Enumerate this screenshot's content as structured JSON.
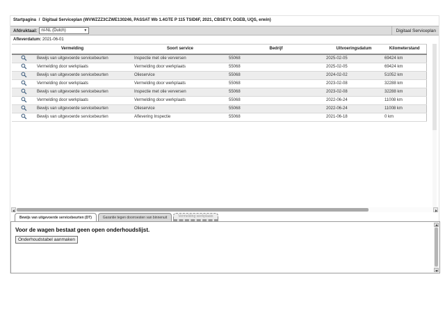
{
  "breadcrumb": {
    "home": "Startpagina",
    "separator": "/",
    "current": "Digitaal Serviceplan (WVWZZZ3CZWE130246, PASSAT Wb 1.4GTE P 115 TSID6F, 2021, CBSEYY, DGEB, UQS, erwin)"
  },
  "toolbar": {
    "language_label": "Afdruktaal:",
    "language_value": "nl-NL (Dutch)",
    "caret": "▼",
    "module_title": "Digitaal Serviceplan"
  },
  "delivery": {
    "label": "Afleverdatum:",
    "value": "2021-06-01"
  },
  "table": {
    "columns": [
      "Vermelding",
      "Soort service",
      "Bedrijf",
      "Uitvoeringsdatum",
      "Kilometerstand"
    ],
    "rows": [
      {
        "vermelding": "Bewijs van uitgevoerde servicebeurten",
        "soort_service": "Inspectie met olie verversen",
        "bedrijf": "55068",
        "uitvoeringsdatum": "2025-02-05",
        "kilometerstand": "69424 km"
      },
      {
        "vermelding": "Vermelding door werkplaats",
        "soort_service": "Vermelding door werkplaats",
        "bedrijf": "55068",
        "uitvoeringsdatum": "2025-02-05",
        "kilometerstand": "69424 km"
      },
      {
        "vermelding": "Bewijs van uitgevoerde servicebeurten",
        "soort_service": "Olieservice",
        "bedrijf": "55068",
        "uitvoeringsdatum": "2024-02-02",
        "kilometerstand": "51052 km"
      },
      {
        "vermelding": "Vermelding door werkplaats",
        "soort_service": "Vermelding door werkplaats",
        "bedrijf": "55068",
        "uitvoeringsdatum": "2023-02-08",
        "kilometerstand": "32288 km"
      },
      {
        "vermelding": "Bewijs van uitgevoerde servicebeurten",
        "soort_service": "Inspectie met olie verversen",
        "bedrijf": "55068",
        "uitvoeringsdatum": "2023-02-08",
        "kilometerstand": "32288 km"
      },
      {
        "vermelding": "Vermelding door werkplaats",
        "soort_service": "Vermelding door werkplaats",
        "bedrijf": "55068",
        "uitvoeringsdatum": "2022-06-24",
        "kilometerstand": "11008 km"
      },
      {
        "vermelding": "Bewijs van uitgevoerde servicebeurten",
        "soort_service": "Olieservice",
        "bedrijf": "55068",
        "uitvoeringsdatum": "2022-06-24",
        "kilometerstand": "11008 km"
      },
      {
        "vermelding": "Bewijs van uitgevoerde servicebeurten",
        "soort_service": "Aflevering Inspectie",
        "bedrijf": "55068",
        "uitvoeringsdatum": "2021-06-18",
        "kilometerstand": "0 km"
      }
    ],
    "row_action_icon": "magnifier-icon"
  },
  "tabs": [
    {
      "label": "Bewijs van uitgevoerde servicebeurten (DT)",
      "state": "active"
    },
    {
      "label": "Garantie tegen doorroesten van binnenuit",
      "state": "normal"
    },
    {
      "label": "Vermelding werkplaats",
      "state": "disabled"
    }
  ],
  "panel": {
    "message": "Voor de wagen bestaat geen open onderhoudslijst.",
    "button_label": "Onderhoudstabel aanmaken"
  },
  "colors": {
    "toolbar_bg": "#dcdcdc",
    "row_stripe": "#ededed",
    "magnifier_icon": "#4a6785",
    "scrollbar_thumb": "#a9a9a9"
  }
}
